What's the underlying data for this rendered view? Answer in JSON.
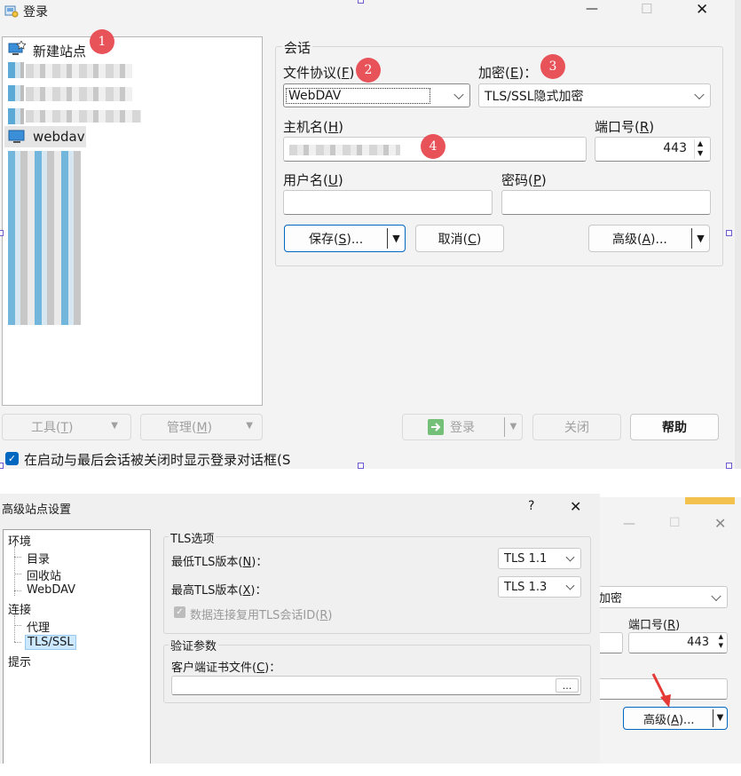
{
  "login_window": {
    "title": "登录",
    "controls": {
      "minimize": "—",
      "maximize": "☐",
      "close": "✕"
    },
    "sites": [
      {
        "label": "新建站点",
        "icon": "new-site-icon"
      },
      {
        "label": "webdav",
        "icon": "computer-icon"
      }
    ],
    "session": {
      "group_label": "会话",
      "protocol": {
        "label": "文件协议(",
        "accel": "F",
        "label_end": ")",
        "value": "WebDAV"
      },
      "encryption": {
        "label": "加密(",
        "accel": "E",
        "label_end": ")：",
        "value": "TLS/SSL隐式加密"
      },
      "host": {
        "label": "主机名(",
        "accel": "H",
        "label_end": ")",
        "value": ""
      },
      "port": {
        "label": "端口号(",
        "accel": "R",
        "label_end": ")",
        "value": "443"
      },
      "user": {
        "label": "用户名(",
        "accel": "U",
        "label_end": ")",
        "value": ""
      },
      "password": {
        "label": "密码(",
        "accel": "P",
        "label_end": ")",
        "value": ""
      }
    },
    "buttons": {
      "save": {
        "label": "保存(",
        "accel": "S",
        "label_end": ")..."
      },
      "cancel": {
        "label": "取消(",
        "accel": "C",
        "label_end": ")"
      },
      "advanced": {
        "label": "高级(",
        "accel": "A",
        "label_end": ")..."
      },
      "tools": {
        "label": "工具(",
        "accel": "T",
        "label_end": ")"
      },
      "manage": {
        "label": "管理(",
        "accel": "M",
        "label_end": ")"
      },
      "login": "登录",
      "close": "关闭",
      "help": "帮助"
    },
    "show_login_checkbox": {
      "label": "在启动与最后会话被关闭时显示登录对话框(S",
      "checked": true
    },
    "badges": [
      "1",
      "2",
      "3",
      "4"
    ]
  },
  "advanced_window": {
    "title": "高级站点设置",
    "controls": {
      "help": "?",
      "close": "✕"
    },
    "tree": [
      {
        "label": "环境",
        "level": 0
      },
      {
        "label": "目录",
        "level": 1
      },
      {
        "label": "回收站",
        "level": 1
      },
      {
        "label": "WebDAV",
        "level": 1
      },
      {
        "label": "连接",
        "level": 0
      },
      {
        "label": "代理",
        "level": 1
      },
      {
        "label": "TLS/SSL",
        "level": 1,
        "selected": true
      },
      {
        "label": "提示",
        "level": 0
      }
    ],
    "tls_group": {
      "title": "TLS选项",
      "min_label": "最低TLS版本(",
      "min_accel": "N",
      "min_label_end": ")：",
      "min_value": "TLS 1.1",
      "max_label": "最高TLS版本(",
      "max_accel": "X",
      "max_label_end": ")：",
      "max_value": "TLS 1.3",
      "reuse_label": "数据连接复用TLS会话ID(",
      "reuse_accel": "R",
      "reuse_label_end": ")",
      "reuse_checked": true
    },
    "auth_group": {
      "title": "验证参数",
      "cert_label": "客户端证书文件(",
      "cert_accel": "C",
      "cert_label_end": ")：",
      "cert_value": "",
      "browse": "..."
    }
  },
  "background_window": {
    "encryption_partial": "加密",
    "port_label": "端口号(",
    "port_accel": "R",
    "port_label_end": ")",
    "port_value": "443",
    "advanced": {
      "label": "高级(",
      "accel": "A",
      "label_end": ")..."
    }
  },
  "colors": {
    "accent": "#0067c0",
    "badge": "#e8535a",
    "selection": "#cce8ff",
    "annotation_arrow": "#e53935"
  }
}
